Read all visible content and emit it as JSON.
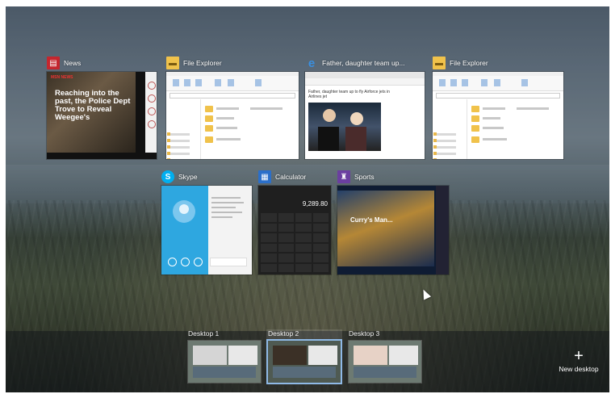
{
  "windows": {
    "row1": [
      {
        "title": "News",
        "icon": "news-icon",
        "color": "#c4262e"
      },
      {
        "title": "File Explorer",
        "icon": "folder-icon",
        "color": "#f0c24b"
      },
      {
        "title": "Father, daughter team up...",
        "icon": "edge-icon",
        "color": "#2b7cd3"
      },
      {
        "title": "File Explorer",
        "icon": "folder-icon",
        "color": "#f0c24b"
      }
    ],
    "row2": [
      {
        "title": "Skype",
        "icon": "skype-icon",
        "color": "#00aff0"
      },
      {
        "title": "Calculator",
        "icon": "calculator-icon",
        "color": "#2b6fc9"
      },
      {
        "title": "Sports",
        "icon": "trophy-icon",
        "color": "#6b3fa0"
      }
    ]
  },
  "news_thumb": {
    "brand": "MSN NEWS",
    "headline": "Reaching into the past, the Police Dept Trove to Reveal Weegee's"
  },
  "edge_thumb": {
    "headline": "Father, daughter team up to fly Airforce jets in Airlines jet"
  },
  "calc_thumb": {
    "display": "9,289.80"
  },
  "sports_thumb": {
    "headline": "Curry's Man..."
  },
  "desktops": [
    {
      "label": "Desktop 1",
      "selected": false
    },
    {
      "label": "Desktop 2",
      "selected": true
    },
    {
      "label": "Desktop 3",
      "selected": false
    }
  ],
  "new_desktop": {
    "label": "New desktop"
  }
}
